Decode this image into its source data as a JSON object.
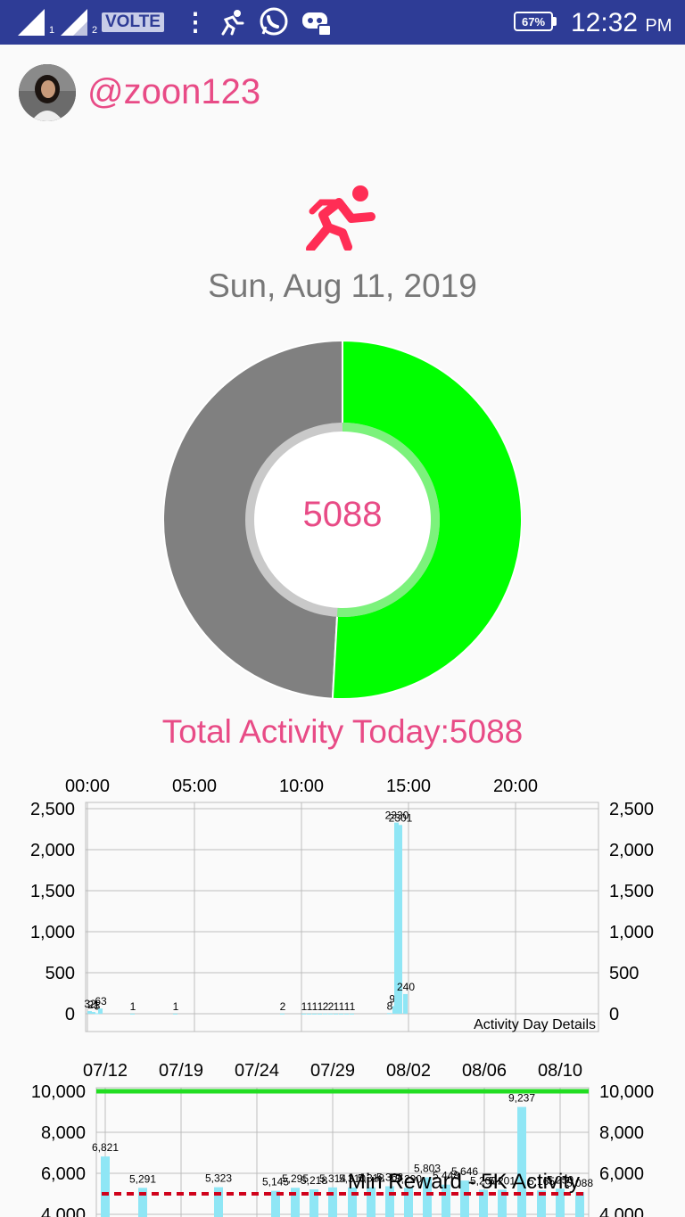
{
  "status_bar": {
    "sim1": "1",
    "sim2": "2",
    "volte": "VOLTE",
    "more_icon": "⋮",
    "battery": "67%",
    "time": "12:32",
    "ampm": "PM",
    "icons": [
      "signal-icon",
      "signal-icon",
      "more-icon",
      "runner-icon",
      "whatsapp-icon",
      "discord-icon",
      "battery-icon"
    ]
  },
  "profile": {
    "username": "@zoon123"
  },
  "date": "Sun, Aug 11, 2019",
  "donut": {
    "center_value": "5088",
    "fraction": 0.5088,
    "colors": {
      "done": "#00ff00",
      "remaining": "#808080"
    }
  },
  "total_label": "Total Activity Today:5088",
  "colors": {
    "accent": "#e84b86",
    "bar": "#8fe6f5",
    "reward_line": "#d0021b",
    "max_line": "#22dd22",
    "statusbar": "#2e3c96"
  },
  "chart_data": [
    {
      "type": "bar",
      "description_label": "Activity Day Details",
      "x_ticks": [
        "00:00",
        "05:00",
        "10:00",
        "15:00",
        "20:00"
      ],
      "xlim_minutes": [
        0,
        1440
      ],
      "ylim": [
        0,
        2500
      ],
      "y_ticks": [
        "0",
        "500",
        "1,000",
        "1,500",
        "2,000",
        "2,500"
      ],
      "grid": true,
      "x_minutes": [
        0,
        15,
        45,
        60,
        120,
        240,
        540,
        600,
        630,
        645,
        660,
        675,
        690,
        705,
        720,
        735,
        750,
        840,
        855,
        870,
        885
      ],
      "values": [
        32,
        21,
        5,
        63,
        1,
        1,
        2,
        1,
        1,
        1,
        1,
        2,
        2,
        1,
        1,
        1,
        1,
        8,
        94,
        2330,
        2301,
        240
      ],
      "labels": [
        "32",
        "21",
        "5",
        "63",
        "1",
        "1",
        "2",
        "1",
        "1",
        "1",
        "1",
        "2",
        "2",
        "1",
        "1",
        "1",
        "1",
        "8",
        "94",
        "2330",
        "2301",
        "240"
      ]
    },
    {
      "type": "bar",
      "x_ticks": [
        "07/12",
        "07/19",
        "07/24",
        "07/29",
        "08/02",
        "08/06",
        "08/10"
      ],
      "ylim": [
        4000,
        10000
      ],
      "y_ticks": [
        "4,000",
        "6,000",
        "8,000",
        "10,000"
      ],
      "grid": true,
      "reward_line": {
        "value": 5000,
        "label": "Min Reward - 5K Activity"
      },
      "max_line": {
        "value": 10000
      },
      "bars": [
        {
          "x": "07/12",
          "value": 6821,
          "label": "6,821"
        },
        {
          "x": "07/14",
          "value": 5291,
          "label": "5,291"
        },
        {
          "x": "07/21",
          "value": 5323,
          "label": "5,323"
        },
        {
          "x": "07/26",
          "value": 5145,
          "label": "5,145"
        },
        {
          "x": "07/27",
          "value": 5295,
          "label": "5,295"
        },
        {
          "x": "07/28",
          "value": 5218,
          "label": "5,218"
        },
        {
          "x": "07/29",
          "value": 5314,
          "label": "5,314"
        },
        {
          "x": "07/30",
          "value": 5310,
          "label": "5,310"
        },
        {
          "x": "07/31",
          "value": 5318,
          "label": "5,318"
        },
        {
          "x": "08/01",
          "value": 5368,
          "label": "5,368"
        },
        {
          "x": "08/02",
          "value": 5290,
          "label": "5,290"
        },
        {
          "x": "08/03",
          "value": 5803,
          "label": "5,803"
        },
        {
          "x": "08/04",
          "value": 5448,
          "label": "5,448"
        },
        {
          "x": "08/05",
          "value": 5646,
          "label": "5,646"
        },
        {
          "x": "08/06",
          "value": 5200,
          "label": "5,200"
        },
        {
          "x": "08/07",
          "value": 5201,
          "label": "5,201"
        },
        {
          "x": "08/08",
          "value": 9237,
          "label": "9,237"
        },
        {
          "x": "08/09",
          "value": 5165,
          "label": "5,165"
        },
        {
          "x": "08/10",
          "value": 5250,
          "label": "5,250"
        },
        {
          "x": "08/11",
          "value": 5088,
          "label": "5,088"
        }
      ]
    }
  ]
}
